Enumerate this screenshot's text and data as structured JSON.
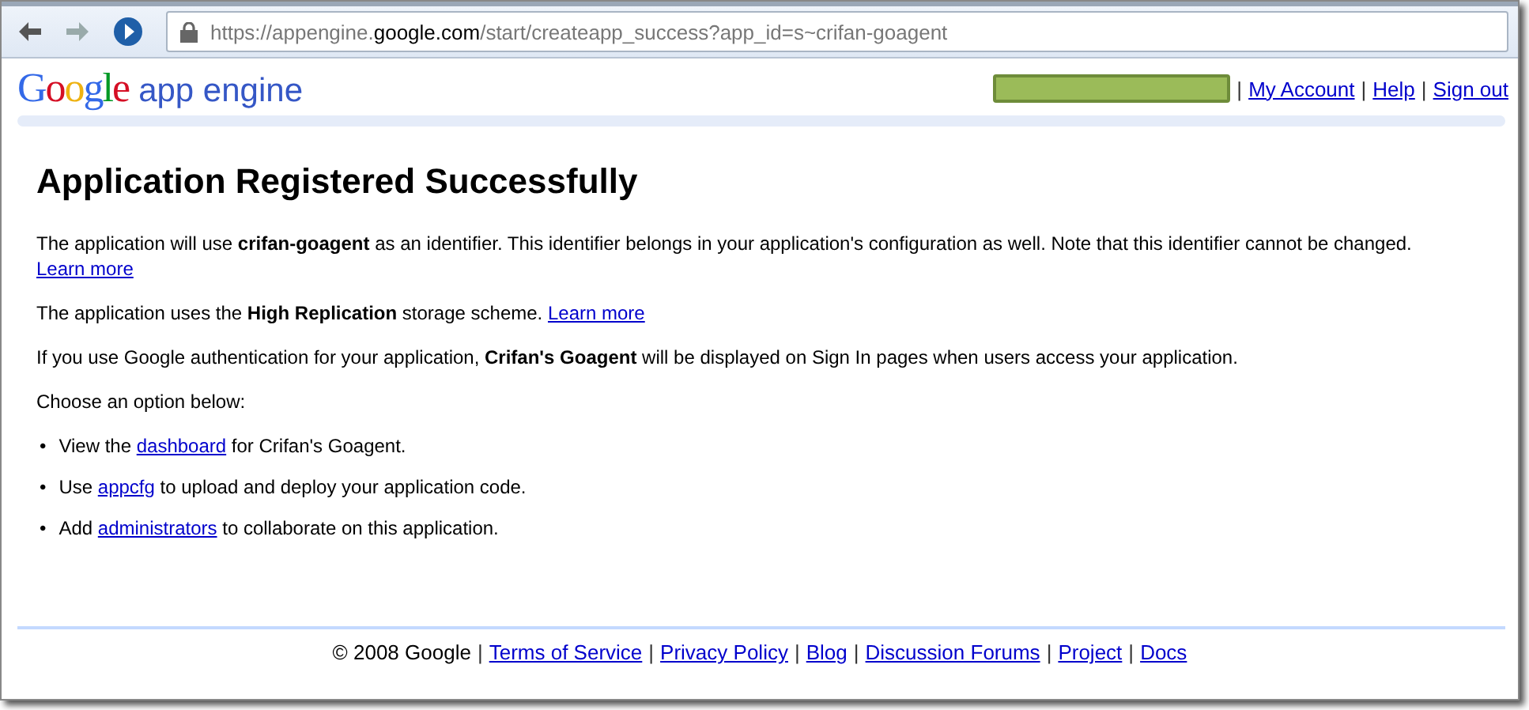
{
  "browser": {
    "url": "https://appengine.**google.com**/start/createapp_success?app_id=s~crifan-goagent"
  },
  "header": {
    "logo_word": "Google",
    "product": "app engine",
    "separator": "|",
    "links": [
      "My Account",
      "Help",
      "Sign out"
    ]
  },
  "title": "Application Registered Successfully",
  "paragraphs": [
    {
      "text": "The application will use **crifan-goagent** as an identifier. This identifier belongs in your application's configuration as well. Note that this identifier cannot be changed.",
      "link": "Learn more"
    },
    {
      "text": "The application uses the **High Replication** storage scheme.",
      "link": "Learn more"
    },
    {
      "text": "If you use Google authentication for your application, **Crifan's Goagent** will be displayed on Sign In pages when users access your application."
    },
    {
      "text": "Choose an option below:"
    }
  ],
  "option_marker": "•",
  "options": [
    {
      "before": "View the",
      "link": "dashboard",
      "after": "for Crifan's Goagent."
    },
    {
      "before": "Use",
      "link": "appcfg",
      "after": "to upload and deploy your application code."
    },
    {
      "before": "Add",
      "link": "administrators",
      "after": "to collaborate on this application."
    }
  ],
  "footer": {
    "copyright": "© 2008 Google",
    "separator": "|",
    "links": [
      "Terms of Service",
      "Privacy Policy",
      "Blog",
      "Discussion Forums",
      "Project",
      "Docs"
    ]
  }
}
